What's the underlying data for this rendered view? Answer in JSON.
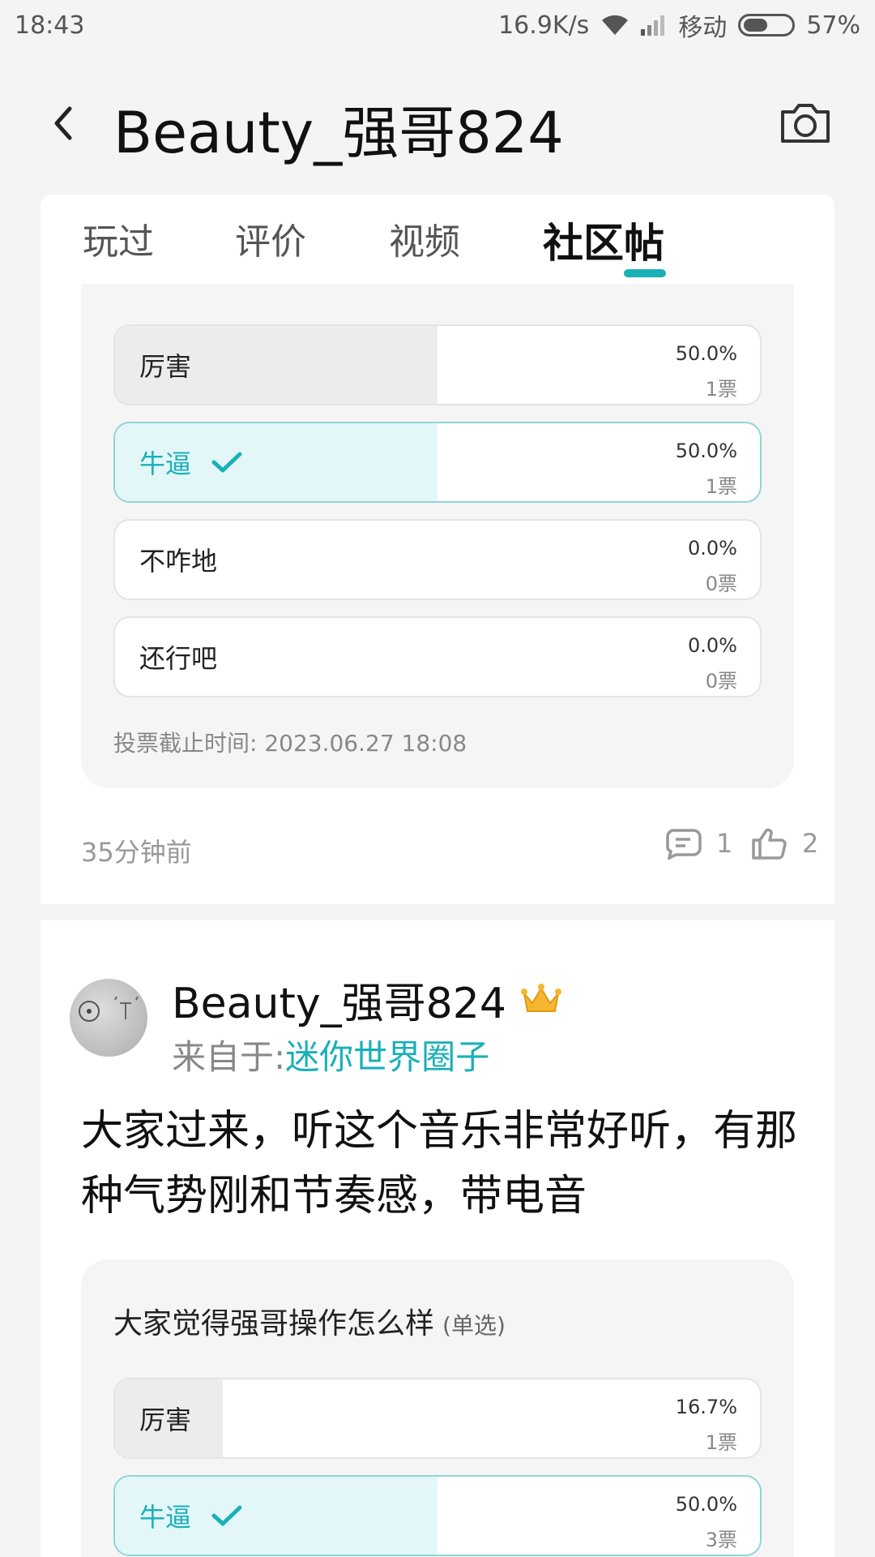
{
  "status_bar": {
    "time": "18:43",
    "speed": "16.9K/s",
    "carrier": "移动",
    "battery": "57%",
    "battery_level": 0.57
  },
  "header": {
    "title": "Beauty_强哥824"
  },
  "tabs": [
    {
      "label": "玩过",
      "active": false
    },
    {
      "label": "评价",
      "active": false
    },
    {
      "label": "视频",
      "active": false
    },
    {
      "label": "社区帖",
      "active": true
    }
  ],
  "post1": {
    "poll": {
      "options": [
        {
          "label": "厉害",
          "percent": "50.0%",
          "votes": "1票",
          "fraction": 0.5,
          "selected": false
        },
        {
          "label": "牛逼",
          "percent": "50.0%",
          "votes": "1票",
          "fraction": 0.5,
          "selected": true
        },
        {
          "label": "不咋地",
          "percent": "0.0%",
          "votes": "0票",
          "fraction": 0.0,
          "selected": false
        },
        {
          "label": "还行吧",
          "percent": "0.0%",
          "votes": "0票",
          "fraction": 0.0,
          "selected": false
        }
      ],
      "deadline": "投票截止时间: 2023.06.27 18:08"
    },
    "time_ago": "35分钟前",
    "comments": "1",
    "likes": "2"
  },
  "post2": {
    "author": "Beauty_强哥824",
    "source_prefix": "来自于:",
    "source_circle": "迷你世界圈子",
    "text": "大家过来，听这个音乐非常好听，有那种气势刚和节奏感，带电音",
    "poll": {
      "question": "大家觉得强哥操作怎么样",
      "mode": "(单选)",
      "options": [
        {
          "label": "厉害",
          "percent": "16.7%",
          "votes": "1票",
          "fraction": 0.167,
          "selected": false
        },
        {
          "label": "牛逼",
          "percent": "50.0%",
          "votes": "3票",
          "fraction": 0.5,
          "selected": true
        }
      ]
    }
  },
  "colors": {
    "accent": "#1ab0b8",
    "crown": "#f5b731"
  }
}
